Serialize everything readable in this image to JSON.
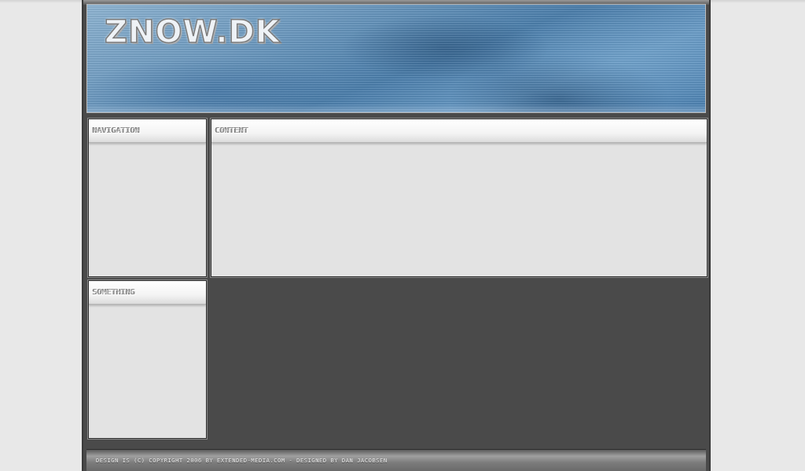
{
  "site": {
    "logo_text": "ZNOW.DK"
  },
  "panels": {
    "navigation": {
      "title": "NAVIGATION"
    },
    "content": {
      "title": "CONTENT"
    },
    "something": {
      "title": "SOMETHING"
    }
  },
  "footer": {
    "text": "DESIGN IS (C) COPYRIGHT 2006 BY EXTENDED-MEDIA.COM - DESIGNED BY DAN JACOBSEN"
  },
  "colors": {
    "page_background": "#e8e8e8",
    "frame": "#4a4a4a",
    "panel_background": "#e3e3e3",
    "header_blue": "#4c7fac"
  }
}
